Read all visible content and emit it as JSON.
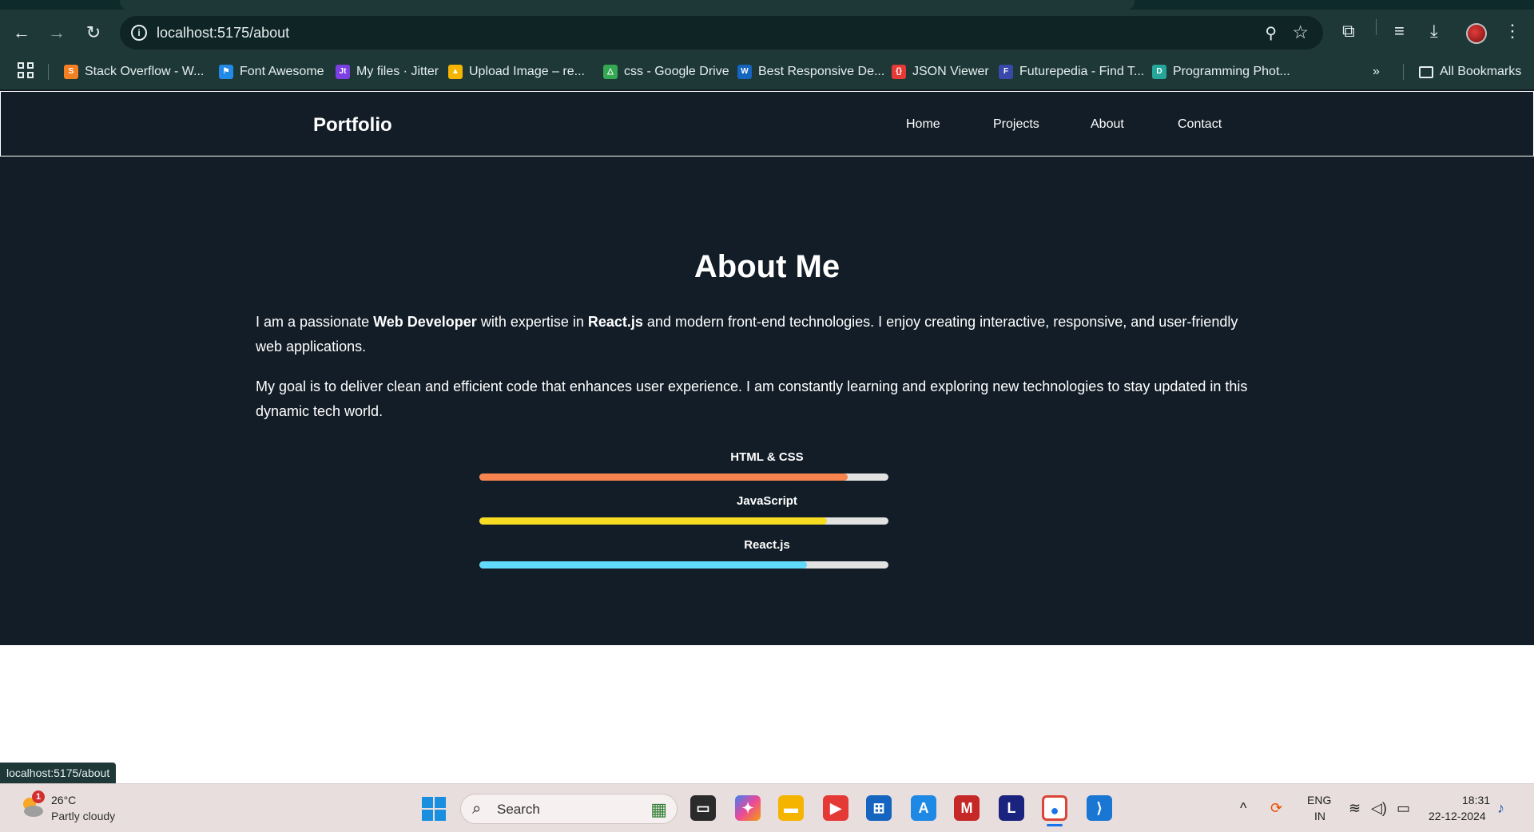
{
  "browser": {
    "url": "localhost:5175/about",
    "bookmarks": [
      {
        "label": "Stack Overflow - W...",
        "icon": "stackoverflow-icon",
        "color": "#f48024"
      },
      {
        "label": "Font Awesome",
        "icon": "fontawesome-icon",
        "color": "#228ae6"
      },
      {
        "label": "My files · Jitter",
        "icon": "jitter-icon",
        "color": "#7b3fe4"
      },
      {
        "label": "Upload Image – re...",
        "icon": "upload-icon",
        "color": "#f4b400"
      },
      {
        "label": "css - Google Drive",
        "icon": "google-drive-icon",
        "color": "#34a853"
      },
      {
        "label": "Best Responsive De...",
        "icon": "responsive-icon",
        "color": "#1565c0"
      },
      {
        "label": "JSON Viewer",
        "icon": "json-icon",
        "color": "#e53935"
      },
      {
        "label": "Futurepedia - Find T...",
        "icon": "futurepedia-icon",
        "color": "#3949ab"
      },
      {
        "label": "Programming Phot...",
        "icon": "photo-icon",
        "color": "#26a69a"
      }
    ],
    "all_bookmarks": "All Bookmarks",
    "status_url": "localhost:5175/about"
  },
  "site": {
    "brand": "Portfolio",
    "nav": [
      "Home",
      "Projects",
      "About",
      "Contact"
    ],
    "heading": "About Me",
    "para1": {
      "t1": "I am a passionate ",
      "b1": "Web Developer",
      "t2": " with expertise in ",
      "b2": "React.js",
      "t3": " and modern front-end technologies. I enjoy creating interactive, responsive, and user-friendly web applications."
    },
    "para2": "My goal is to deliver clean and efficient code that enhances user experience. I am constantly learning and exploring new technologies to stay updated in this dynamic tech world.",
    "skills": [
      {
        "name": "HTML & CSS",
        "level": 0.9,
        "color": "#f7834f"
      },
      {
        "name": "JavaScript",
        "level": 0.85,
        "color": "#f7dc22"
      },
      {
        "name": "React.js",
        "level": 0.8,
        "color": "#61dafb"
      }
    ]
  },
  "taskbar": {
    "weather_badge": "1",
    "temperature": "26°C",
    "condition": "Partly cloudy",
    "search_placeholder": "Search",
    "lang_line1": "ENG",
    "lang_line2": "IN",
    "time": "18:31",
    "date": "22-12-2024"
  }
}
